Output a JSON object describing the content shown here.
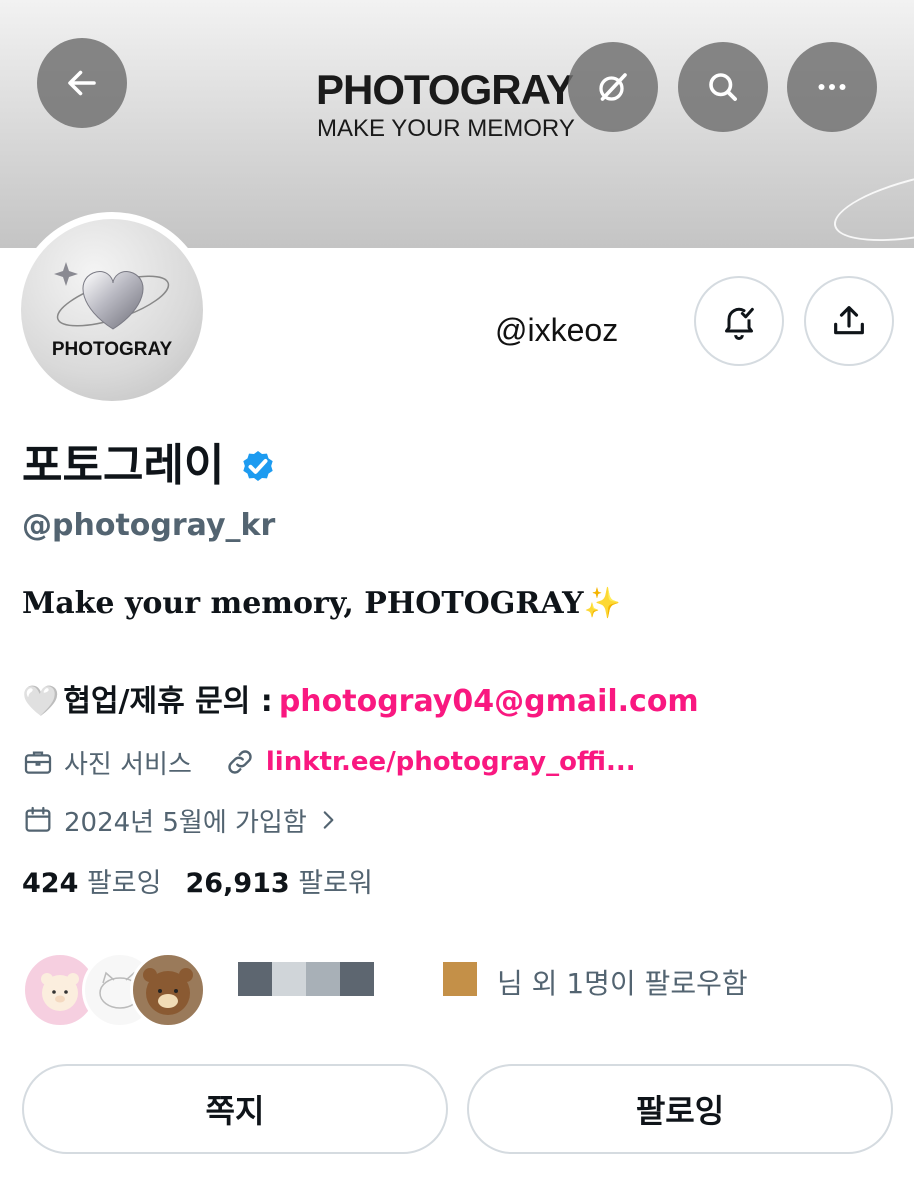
{
  "banner": {
    "brand": "PHOTOGRAY",
    "tagline": "MAKE YOUR MEMORY"
  },
  "header": {
    "back_icon": "arrow-left-icon",
    "grok_icon": "slash-circle-icon",
    "search_icon": "search-icon",
    "more_icon": "more-icon"
  },
  "avatar": {
    "text": "PHOTOGRAY"
  },
  "overlay_handle": "@ixkeoz",
  "actions": {
    "notify_icon": "bell-check-icon",
    "share_icon": "share-icon"
  },
  "profile": {
    "display_name": "포토그레이",
    "username": "@photogray_kr",
    "bio_line1": "Make your memory, PHOTOGRAY✨",
    "bio_emoji": "🤍",
    "bio_label": "협업/제휴 문의 :",
    "bio_email": "photogray04@gmail.com",
    "category": "사진 서비스",
    "website": "linktr.ee/photogray_offi...",
    "joined": "2024년 5월에 가입함"
  },
  "stats": {
    "following_count": "424",
    "following_label": "팔로잉",
    "followers_count": "26,913",
    "followers_label": "팔로워"
  },
  "followed_by": {
    "text": "님 외 1명이 팔로우함"
  },
  "buttons": {
    "message": "쪽지",
    "following": "팔로잉"
  },
  "colors": {
    "accent_pink": "#f91880",
    "verified_blue": "#1d9bf0",
    "muted_text": "#536471"
  }
}
